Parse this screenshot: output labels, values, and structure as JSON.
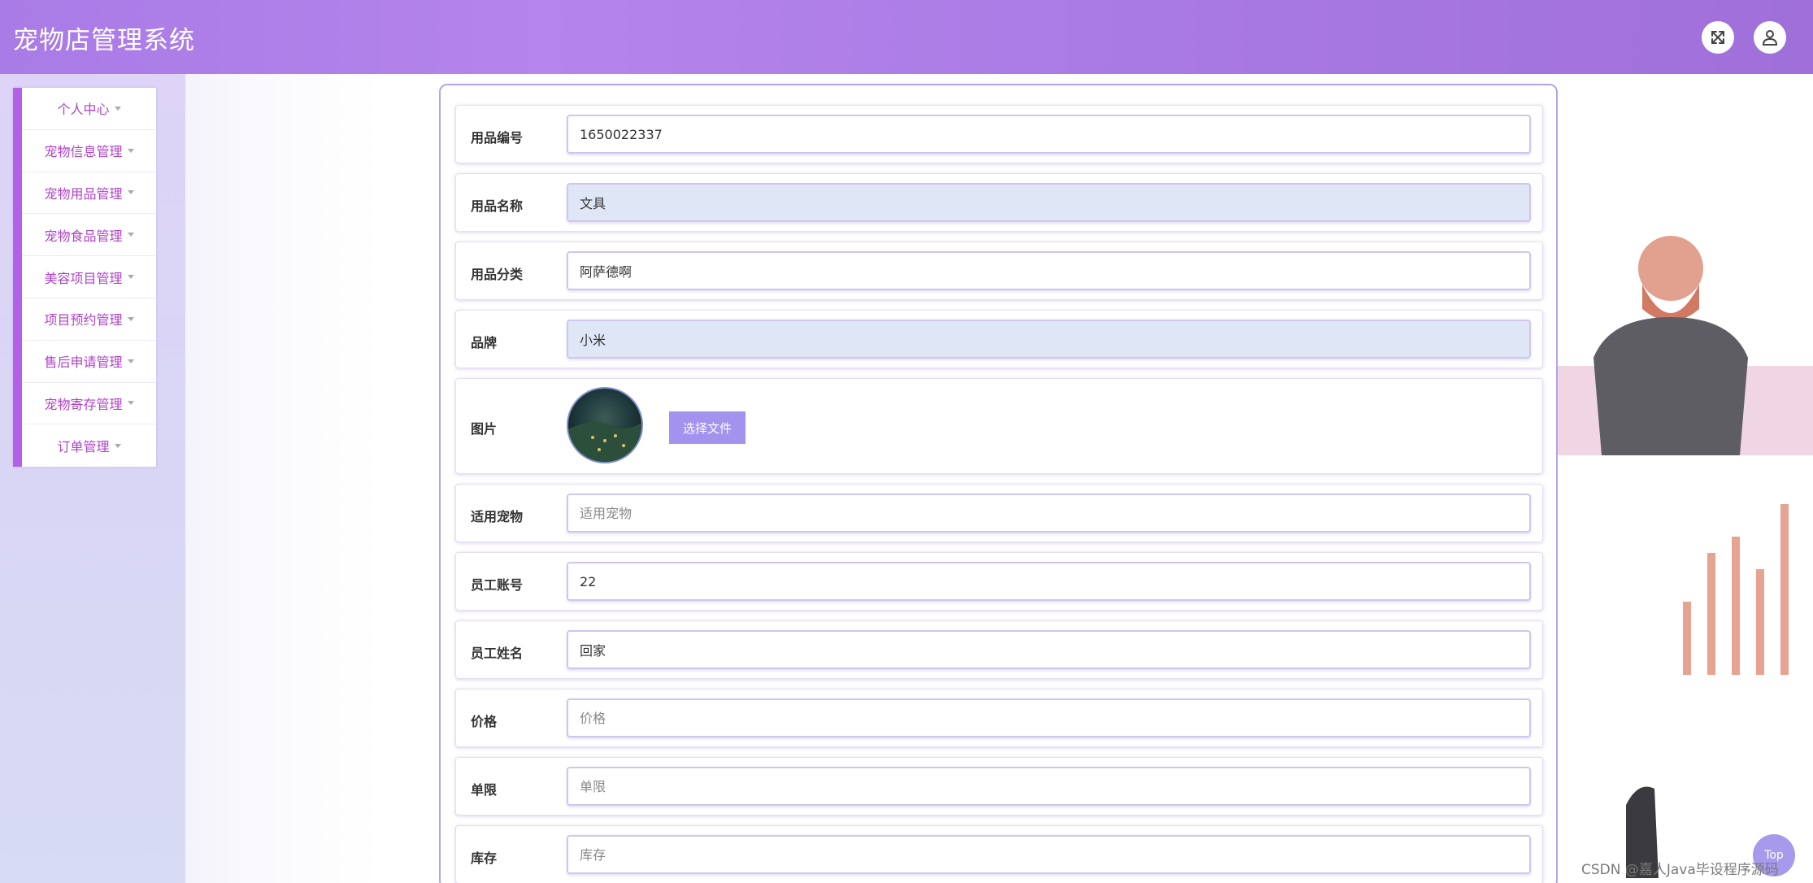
{
  "header": {
    "title": "宠物店管理系统",
    "fullscreen_icon": "expand-icon",
    "user_icon": "user-icon",
    "accent": "#ab7be5"
  },
  "sidebar": {
    "accent": "#b35fe8",
    "items": [
      {
        "label": "个人中心"
      },
      {
        "label": "宠物信息管理"
      },
      {
        "label": "宠物用品管理"
      },
      {
        "label": "宠物食品管理"
      },
      {
        "label": "美容项目管理"
      },
      {
        "label": "项目预约管理"
      },
      {
        "label": "售后申请管理"
      },
      {
        "label": "宠物寄存管理"
      },
      {
        "label": "订单管理"
      }
    ]
  },
  "form": {
    "fields": [
      {
        "label": "用品编号",
        "value": "1650022337",
        "placeholder": ""
      },
      {
        "label": "用品名称",
        "value": "文具",
        "placeholder": ""
      },
      {
        "label": "用品分类",
        "value": "阿萨德啊",
        "placeholder": ""
      },
      {
        "label": "品牌",
        "value": "小米",
        "placeholder": ""
      },
      {
        "label": "图片",
        "button": "选择文件"
      },
      {
        "label": "适用宠物",
        "value": "",
        "placeholder": "适用宠物"
      },
      {
        "label": "员工账号",
        "value": "22",
        "placeholder": ""
      },
      {
        "label": "员工姓名",
        "value": "回家",
        "placeholder": ""
      },
      {
        "label": "价格",
        "value": "",
        "placeholder": "价格"
      },
      {
        "label": "单限",
        "value": "",
        "placeholder": "单限"
      },
      {
        "label": "库存",
        "value": "",
        "placeholder": "库存"
      }
    ]
  },
  "top_button": "Top",
  "watermark": "CSDN @嘉人Java毕设程序源码"
}
